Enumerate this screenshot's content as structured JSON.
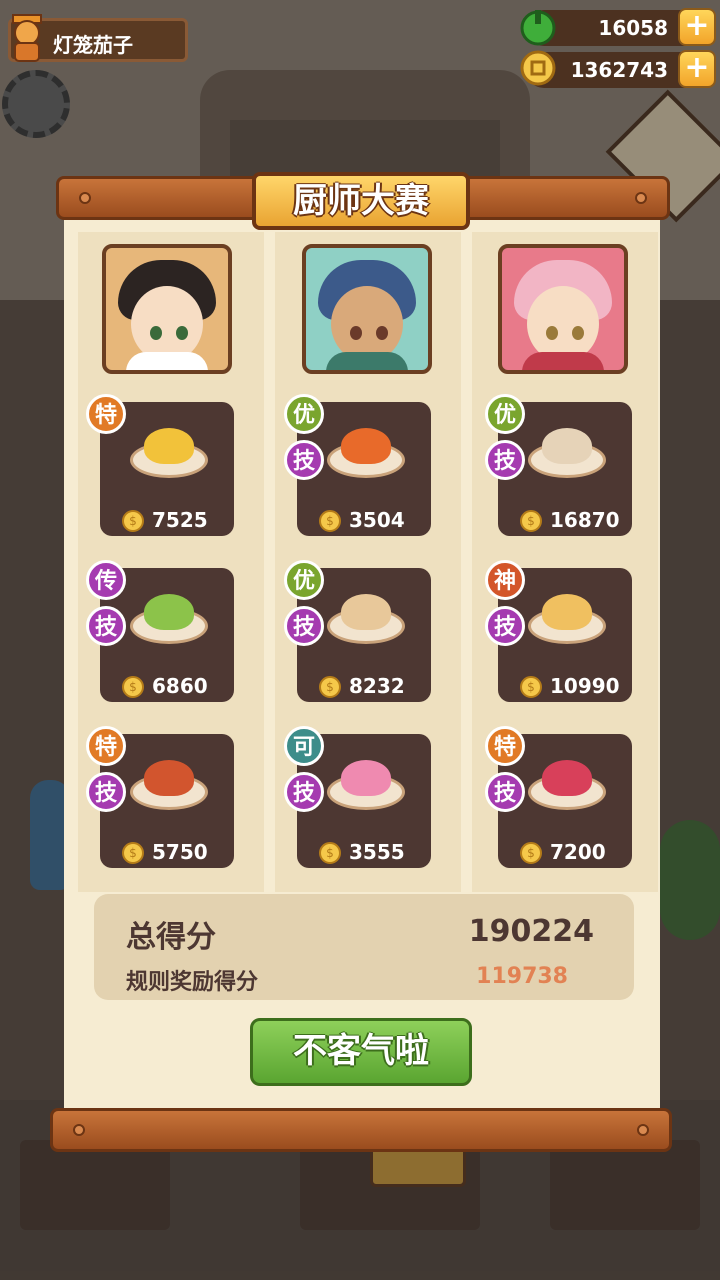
{
  "player": {
    "name": "灯笼茄子"
  },
  "resources": {
    "gems": "16058",
    "coins": "1362743"
  },
  "modal": {
    "title": "厨师大赛",
    "confirm_label": "不客气啦",
    "total_label": "总得分",
    "total_value": "190224",
    "bonus_label": "规则奖励得分",
    "bonus_value": "119738"
  },
  "skill_badge": "技",
  "columns": [
    {
      "chef": "chef-girl-red-hair-clip",
      "dishes": [
        {
          "grade": "特",
          "skill": false,
          "price": "7525"
        },
        {
          "grade": "传",
          "skill": true,
          "price": "6860"
        },
        {
          "grade": "特",
          "skill": true,
          "price": "5750"
        }
      ]
    },
    {
      "chef": "chef-boy-headdress",
      "dishes": [
        {
          "grade": "优",
          "skill": true,
          "price": "3504"
        },
        {
          "grade": "优",
          "skill": true,
          "price": "8232"
        },
        {
          "grade": "可",
          "skill": true,
          "price": "3555"
        }
      ]
    },
    {
      "chef": "chef-girl-pink-hair",
      "dishes": [
        {
          "grade": "优",
          "skill": true,
          "price": "16870"
        },
        {
          "grade": "神",
          "skill": true,
          "price": "10990"
        },
        {
          "grade": "特",
          "skill": true,
          "price": "7200"
        }
      ]
    }
  ],
  "colors": {
    "accent": "#e9a432",
    "confirm": "#5aa531",
    "bonus": "#e28253",
    "card": "#4d3732"
  }
}
